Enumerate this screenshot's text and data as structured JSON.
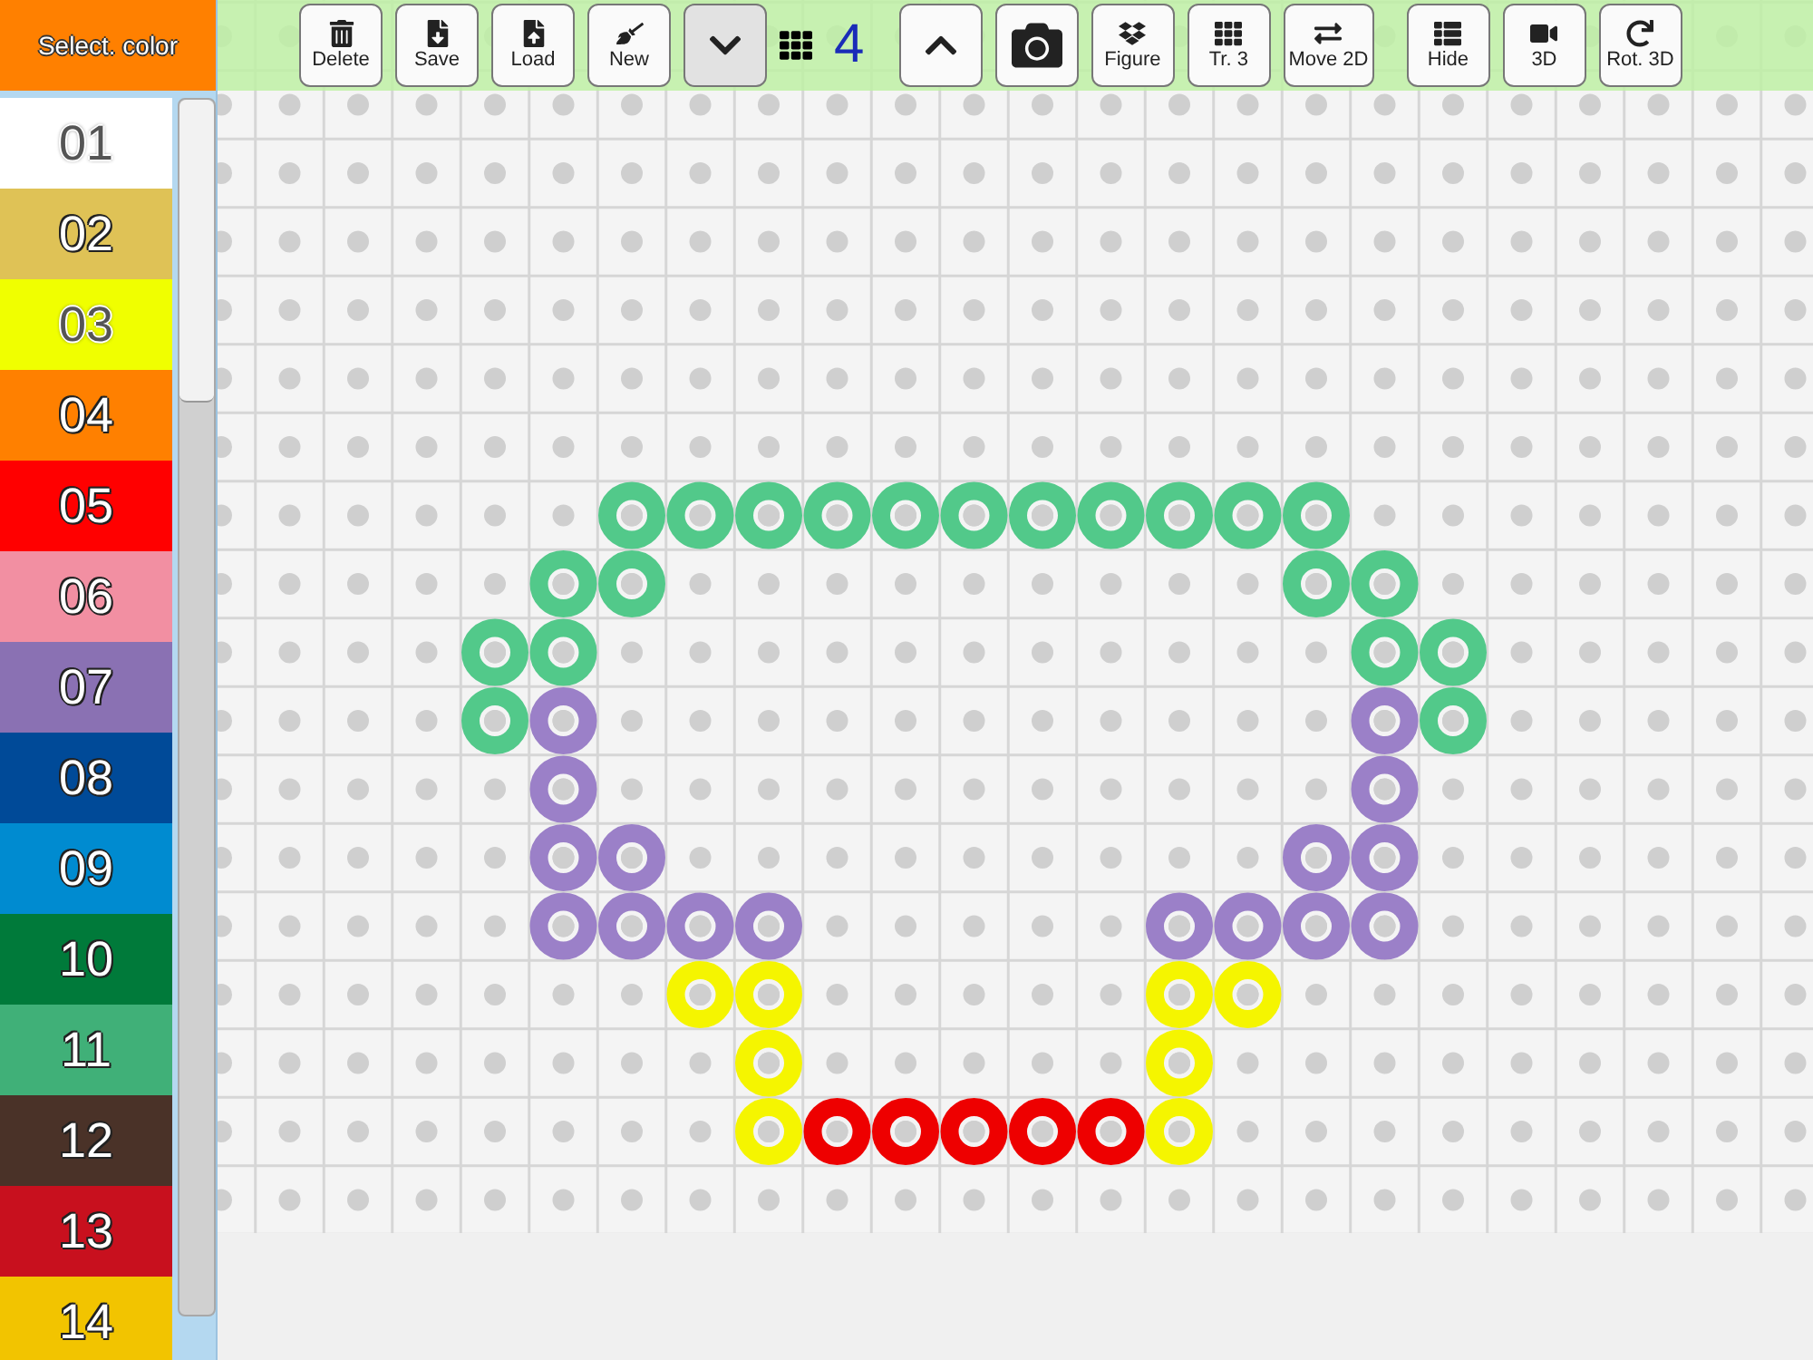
{
  "sidebar": {
    "title": "Select. color",
    "palette": [
      {
        "label": "01",
        "color": "#ffffff"
      },
      {
        "label": "02",
        "color": "#dfc256"
      },
      {
        "label": "03",
        "color": "#f0ff00"
      },
      {
        "label": "04",
        "color": "#ff8000"
      },
      {
        "label": "05",
        "color": "#ff0000"
      },
      {
        "label": "06",
        "color": "#f28fa2"
      },
      {
        "label": "07",
        "color": "#8a71b3"
      },
      {
        "label": "08",
        "color": "#004a98"
      },
      {
        "label": "09",
        "color": "#008bd0"
      },
      {
        "label": "10",
        "color": "#007a3a"
      },
      {
        "label": "11",
        "color": "#40b078"
      },
      {
        "label": "12",
        "color": "#4a3228"
      },
      {
        "label": "13",
        "color": "#c8101e"
      },
      {
        "label": "14",
        "color": "#f2c400"
      }
    ]
  },
  "toolbar": [
    {
      "kind": "button",
      "label": "Delete"
    },
    {
      "kind": "button",
      "label": "Save"
    },
    {
      "kind": "button",
      "label": "Load"
    },
    {
      "kind": "button",
      "label": "New"
    },
    {
      "kind": "step",
      "pressed": true
    },
    {
      "kind": "level",
      "value": "4"
    },
    {
      "kind": "step",
      "pressed": false
    },
    {
      "kind": "photo"
    },
    {
      "kind": "button",
      "label": "Figure"
    },
    {
      "kind": "button",
      "label": "Tr. 3"
    },
    {
      "kind": "button",
      "label": "Move 2D"
    },
    {
      "kind": "button",
      "label": "Hide"
    },
    {
      "kind": "button",
      "label": "3D"
    },
    {
      "kind": "button",
      "label": "Rot. 3D"
    }
  ],
  "board": [
    {
      "cells": [
        null,
        null,
        null,
        null,
        null,
        null,
        null,
        null,
        null,
        null,
        null,
        null,
        null,
        null,
        null,
        null,
        null,
        null,
        null
      ]
    },
    {
      "cells": [
        null,
        null,
        null,
        null,
        null,
        null,
        null,
        null,
        null,
        null,
        null,
        null,
        null,
        null,
        null,
        null,
        null,
        null,
        null
      ]
    },
    {
      "cells": [
        null,
        null,
        null,
        null,
        null,
        null,
        null,
        null,
        null,
        null,
        null,
        null,
        null,
        null,
        null,
        null,
        null,
        null,
        null
      ]
    },
    {
      "cells": [
        null,
        null,
        null,
        null,
        null,
        null,
        null,
        null,
        null,
        null,
        null,
        null,
        null,
        null,
        null,
        null,
        null,
        null,
        null
      ]
    },
    {
      "cells": [
        null,
        null,
        null,
        null,
        null,
        null,
        null,
        null,
        null,
        null,
        null,
        null,
        null,
        null,
        null,
        null,
        null,
        null,
        null
      ]
    },
    {
      "cells": [
        null,
        null,
        null,
        null,
        null,
        null,
        null,
        null,
        null,
        null,
        null,
        null,
        null,
        null,
        null,
        null,
        null,
        null,
        null
      ]
    },
    {
      "cells": [
        null,
        null,
        null,
        null,
        null,
        null,
        null,
        null,
        null,
        null,
        null,
        null,
        null,
        null,
        null,
        null,
        null,
        null,
        null
      ]
    },
    {
      "cells": [
        null,
        null,
        null,
        null,
        null,
        null,
        {
          "color": "#52c98a"
        },
        {
          "color": "#52c98a"
        },
        {
          "color": "#52c98a"
        },
        {
          "color": "#52c98a"
        },
        {
          "color": "#52c98a"
        },
        {
          "color": "#52c98a"
        },
        {
          "color": "#52c98a"
        },
        {
          "color": "#52c98a"
        },
        {
          "color": "#52c98a"
        },
        {
          "color": "#52c98a"
        },
        {
          "color": "#52c98a"
        },
        null,
        null
      ]
    },
    {
      "cells": [
        null,
        null,
        null,
        null,
        null,
        {
          "color": "#52c98a"
        },
        {
          "color": "#52c98a"
        },
        null,
        null,
        null,
        null,
        null,
        null,
        null,
        null,
        null,
        {
          "color": "#52c98a"
        },
        {
          "color": "#52c98a"
        },
        null
      ]
    },
    {
      "cells": [
        null,
        null,
        null,
        null,
        {
          "color": "#52c98a"
        },
        {
          "color": "#52c98a"
        },
        null,
        null,
        null,
        null,
        null,
        null,
        null,
        null,
        null,
        null,
        null,
        {
          "color": "#52c98a"
        },
        {
          "color": "#52c98a"
        }
      ]
    },
    {
      "cells": [
        null,
        null,
        null,
        null,
        {
          "color": "#52c98a"
        },
        {
          "color": "#9b80c8"
        },
        null,
        null,
        null,
        null,
        null,
        null,
        null,
        null,
        null,
        null,
        null,
        {
          "color": "#9b80c8"
        },
        {
          "color": "#52c98a"
        }
      ]
    },
    {
      "cells": [
        null,
        null,
        null,
        null,
        null,
        {
          "color": "#9b80c8"
        },
        null,
        null,
        null,
        null,
        null,
        null,
        null,
        null,
        null,
        null,
        null,
        {
          "color": "#9b80c8"
        },
        null
      ]
    },
    {
      "cells": [
        null,
        null,
        null,
        null,
        null,
        {
          "color": "#9b80c8"
        },
        {
          "color": "#9b80c8"
        },
        null,
        null,
        null,
        null,
        null,
        null,
        null,
        null,
        null,
        {
          "color": "#9b80c8"
        },
        {
          "color": "#9b80c8"
        },
        null
      ]
    },
    {
      "cells": [
        null,
        null,
        null,
        null,
        null,
        {
          "color": "#9b80c8"
        },
        {
          "color": "#9b80c8"
        },
        {
          "color": "#9b80c8"
        },
        {
          "color": "#9b80c8"
        },
        null,
        null,
        null,
        null,
        null,
        {
          "color": "#9b80c8"
        },
        {
          "color": "#9b80c8"
        },
        {
          "color": "#9b80c8"
        },
        {
          "color": "#9b80c8"
        },
        null
      ]
    },
    {
      "cells": [
        null,
        null,
        null,
        null,
        null,
        null,
        null,
        {
          "color": "#f5f500"
        },
        {
          "color": "#f5f500"
        },
        null,
        null,
        null,
        null,
        null,
        {
          "color": "#f5f500"
        },
        {
          "color": "#f5f500"
        },
        null,
        null,
        null
      ]
    },
    {
      "cells": [
        null,
        null,
        null,
        null,
        null,
        null,
        null,
        null,
        {
          "color": "#f5f500"
        },
        null,
        null,
        null,
        null,
        null,
        {
          "color": "#f5f500"
        },
        null,
        null,
        null,
        null
      ]
    },
    {
      "cells": [
        null,
        null,
        null,
        null,
        null,
        null,
        null,
        null,
        {
          "color": "#f5f500"
        },
        {
          "color": "#ee0000"
        },
        {
          "color": "#ee0000"
        },
        {
          "color": "#ee0000"
        },
        {
          "color": "#ee0000"
        },
        {
          "color": "#ee0000"
        },
        {
          "color": "#f5f500"
        },
        null,
        null,
        null,
        null
      ]
    }
  ]
}
